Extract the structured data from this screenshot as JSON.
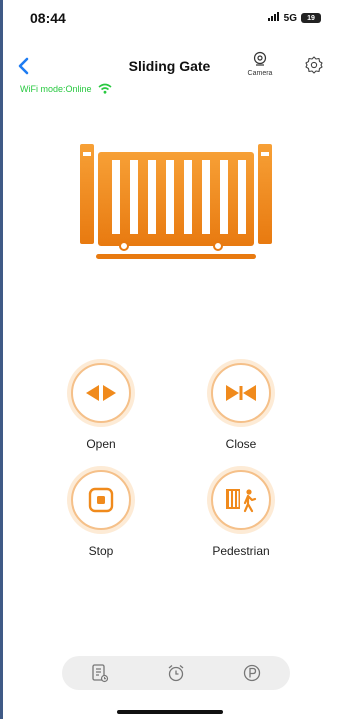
{
  "status_bar": {
    "time": "08:44",
    "signal": "5G",
    "battery": "19"
  },
  "header": {
    "title": "Sliding Gate",
    "camera_label": "Camera"
  },
  "wifi": {
    "text": "WiFi mode:Online",
    "color": "#28c940"
  },
  "accent_color": "#f08a1c",
  "controls": [
    {
      "label": "Open",
      "icon": "open-arrows-icon"
    },
    {
      "label": "Close",
      "icon": "close-arrows-icon"
    },
    {
      "label": "Stop",
      "icon": "stop-icon"
    },
    {
      "label": "Pedestrian",
      "icon": "pedestrian-icon"
    }
  ],
  "tabs": [
    {
      "icon": "log-icon"
    },
    {
      "icon": "alarm-clock-icon"
    },
    {
      "icon": "parking-icon"
    }
  ]
}
